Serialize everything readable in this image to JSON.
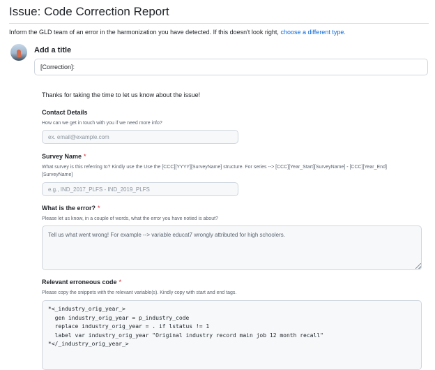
{
  "page": {
    "title": "Issue: Code Correction Report",
    "intro_text": "Inform the GLD team of an error in the harmonization you have detected. If this doesn't look right, ",
    "intro_link": "choose a different type.",
    "link_color": "#0969da",
    "required_color": "#cf222e"
  },
  "title_field": {
    "label": "Add a title",
    "value": "[Correction]:"
  },
  "form": {
    "thanks": "Thanks for taking the time to let us know about the issue!",
    "contact": {
      "label": "Contact Details",
      "description": "How can we get in touch with you if we need more info?",
      "placeholder": "ex. email@example.com"
    },
    "survey": {
      "label": "Survey Name",
      "required_mark": "*",
      "description": "What survey is this referring to? Kindly use the Use the [CCC][YYYY][SurveyName] structure. For series --> [CCC][Year_Start][SurveyName] - [CCC][Year_End][SurveyName]",
      "placeholder": "e.g., IND_2017_PLFS - IND_2019_PLFS"
    },
    "error": {
      "label": "What is the error?",
      "required_mark": "*",
      "description": "Please let us know, in a couple of words, what the error you have notied is about?",
      "placeholder": "Tell us what went wrong! For example --> variable educat7 wrongly attributed for high schoolers."
    },
    "code": {
      "label": "Relevant erroneous code",
      "required_mark": "*",
      "description": "Please copy the snippets with the relevant variable(s). Kindly copy with start and end tags.",
      "lines": [
        "*<_industry_orig_year_>",
        "  gen industry_orig_year = p_industry_code",
        "  replace industry_orig_year = . if lstatus != 1",
        "  label var industry_orig_year \"Original industry record main job 12 month recall\"",
        "*</_industry_orig_year_>"
      ]
    }
  }
}
